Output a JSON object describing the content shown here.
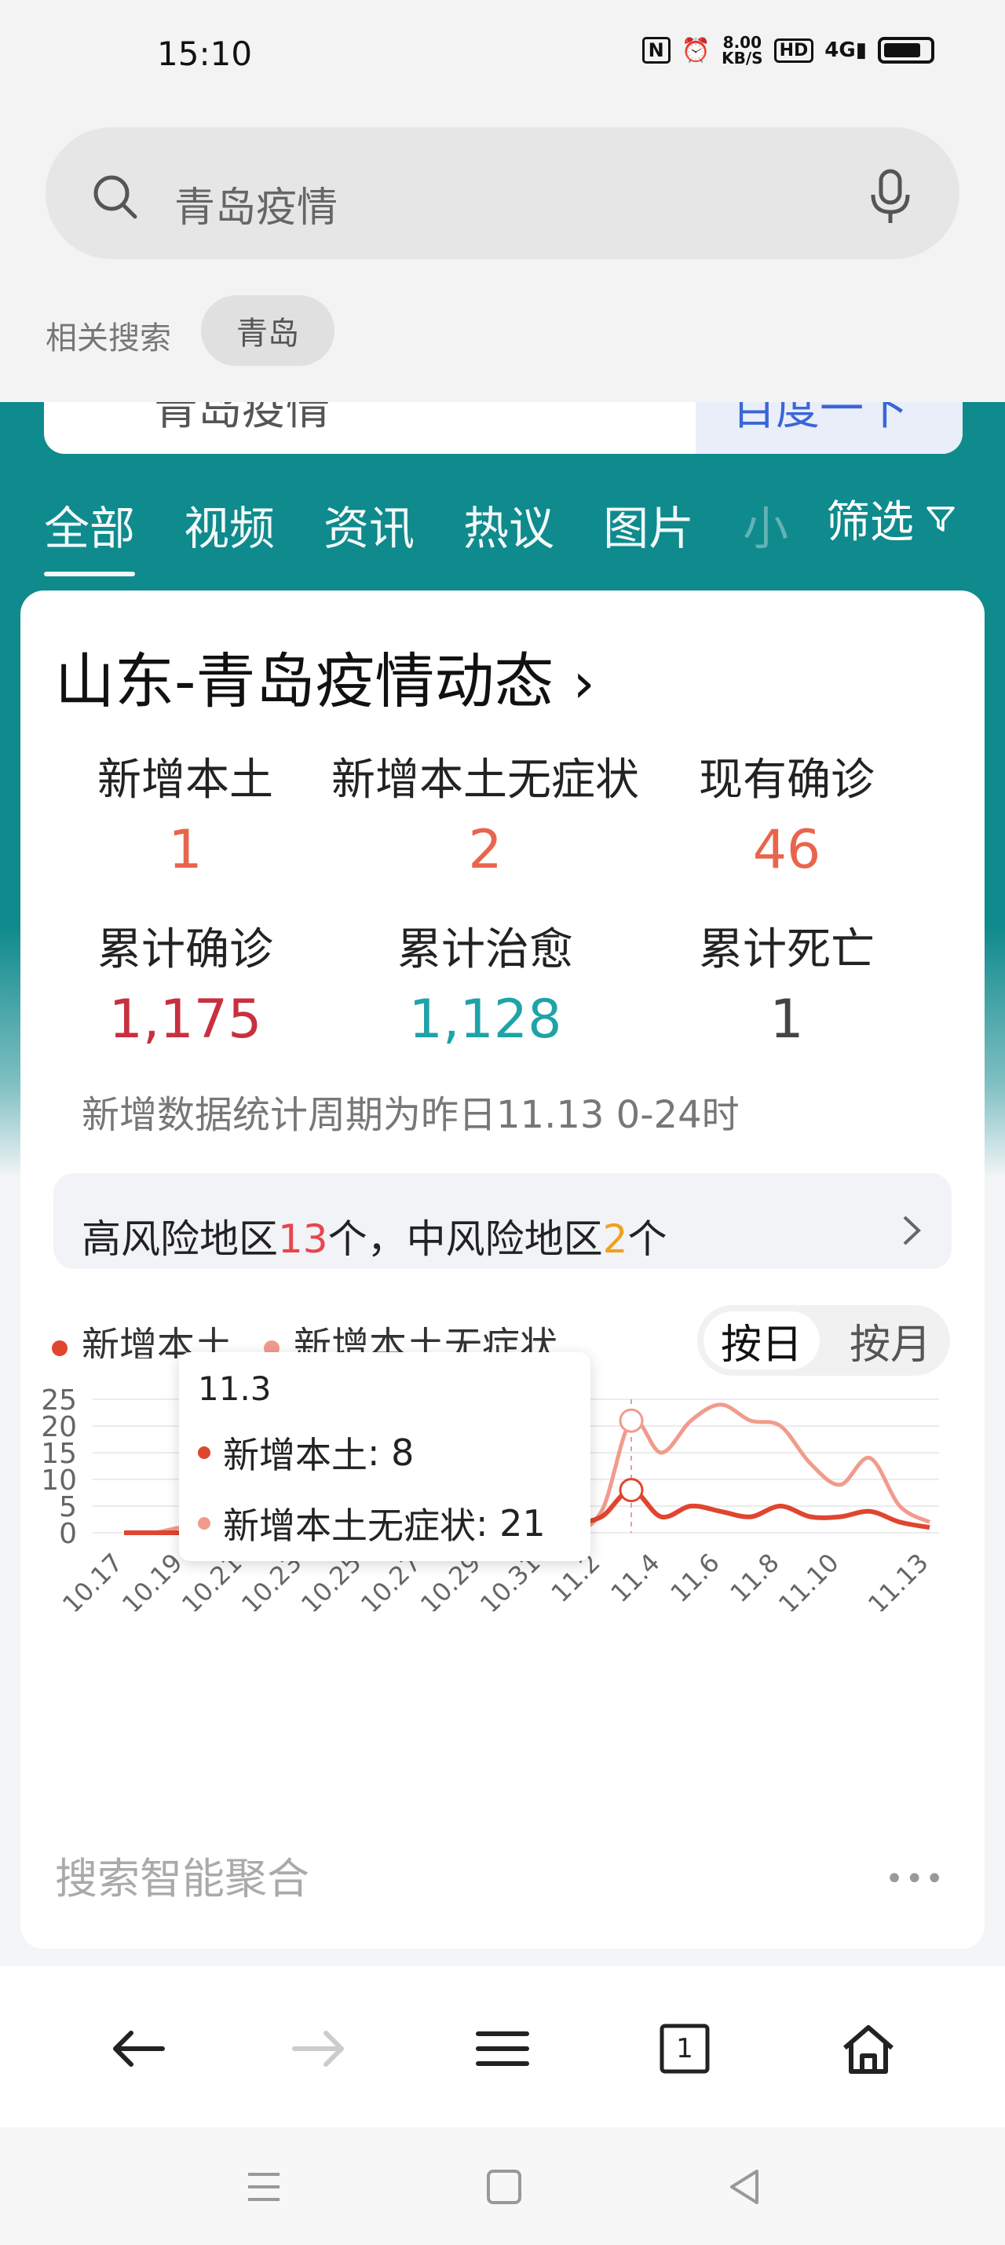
{
  "status_bar": {
    "time": "15:10",
    "speed": "8.00",
    "speed_unit": "KB/S",
    "hd": "HD",
    "network": "4G"
  },
  "search": {
    "query": "青岛疫情"
  },
  "related": {
    "label": "相关搜索",
    "chip": "青岛"
  },
  "behind_bar": {
    "text": "青岛疫情",
    "right": "百度一下"
  },
  "tabs": [
    {
      "label": "全部"
    },
    {
      "label": "视频"
    },
    {
      "label": "资讯"
    },
    {
      "label": "热议"
    },
    {
      "label": "图片"
    },
    {
      "label": "小"
    }
  ],
  "filter": {
    "label": "筛选"
  },
  "card": {
    "title": "山东-青岛疫情动态",
    "stats": [
      {
        "label": "新增本土",
        "value": "1",
        "color": "#e8654d"
      },
      {
        "label": "新增本土无症状",
        "value": "2",
        "color": "#e8654d"
      },
      {
        "label": "现有确诊",
        "value": "46",
        "color": "#e8654d"
      },
      {
        "label": "累计确诊",
        "value": "1,175",
        "color": "#c8303f"
      },
      {
        "label": "累计治愈",
        "value": "1,128",
        "color": "#1ea3a8"
      },
      {
        "label": "累计死亡",
        "value": "1",
        "color": "#444444"
      }
    ],
    "note": "新增数据统计周期为昨日11.13 0-24时",
    "risk": {
      "prefix": "高风险地区",
      "high": "13",
      "middle": "个，中风险地区",
      "medium": "2",
      "suffix": "个",
      "high_color": "#e8454d",
      "medium_color": "#f0a020"
    },
    "toggle": {
      "day": "按日",
      "month": "按月"
    },
    "aggregate": "搜索智能聚合",
    "more": "•••"
  },
  "chart_data": {
    "type": "line",
    "categories": [
      "10.17",
      "10.18",
      "10.19",
      "10.20",
      "10.21",
      "10.22",
      "10.23",
      "10.24",
      "10.25",
      "10.26",
      "10.27",
      "10.28",
      "10.29",
      "10.30",
      "10.31",
      "11.1",
      "11.2",
      "11.3",
      "11.4",
      "11.5",
      "11.6",
      "11.7",
      "11.8",
      "11.9",
      "11.10",
      "11.11",
      "11.12",
      "11.13"
    ],
    "tick_labels": [
      "10.17",
      "10.19",
      "10.21",
      "10.23",
      "10.25",
      "10.27",
      "10.29",
      "10.31",
      "11.2",
      "11.4",
      "11.6",
      "11.8",
      "11.10",
      "11.13"
    ],
    "series": [
      {
        "name": "新增本土",
        "color": "#e0452f",
        "values": [
          0,
          0,
          0,
          0,
          0,
          0,
          0,
          0,
          0,
          0,
          0,
          0,
          2,
          0,
          4,
          2,
          3,
          8,
          3,
          5,
          4,
          3,
          5,
          3,
          3,
          4,
          2,
          1
        ]
      },
      {
        "name": "新增本土无症状",
        "color": "#f19b8c",
        "values": [
          0,
          0,
          1,
          0,
          0,
          0,
          0,
          0,
          0,
          1,
          1,
          2,
          0,
          3,
          16,
          2,
          4,
          21,
          15,
          21,
          24,
          21,
          20,
          13,
          9,
          14,
          5,
          2
        ]
      }
    ],
    "ylim": [
      0,
      25
    ],
    "yticks": [
      0,
      5,
      10,
      15,
      20,
      25
    ],
    "grid": true,
    "legend": "top-left",
    "tooltip": {
      "title": "11.3",
      "rows": [
        {
          "name": "新增本土",
          "value": "8"
        },
        {
          "name": "新增本土无症状",
          "value": "21"
        }
      ]
    },
    "highlight_index": 17
  },
  "nav_bar": {
    "tabs_count": "1"
  }
}
